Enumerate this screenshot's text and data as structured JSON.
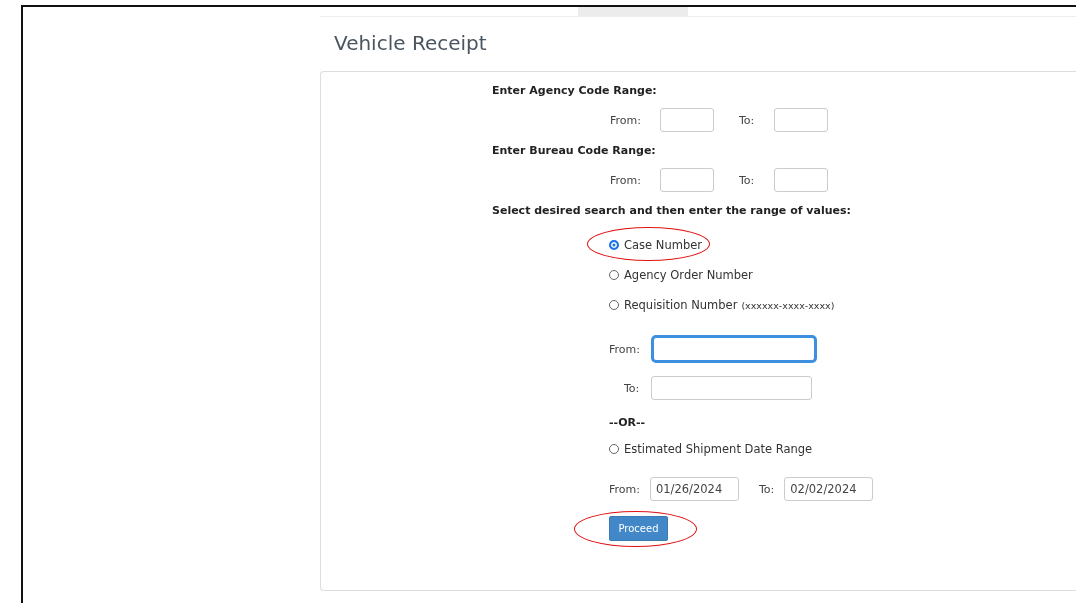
{
  "page": {
    "title": "Vehicle Receipt"
  },
  "agency_range": {
    "heading": "Enter Agency Code Range:",
    "from_label": "From:",
    "to_label": "To:"
  },
  "bureau_range": {
    "heading": "Enter Bureau Code Range:",
    "from_label": "From:",
    "to_label": "To:"
  },
  "search_heading": "Select desired search and then enter the range of values:",
  "search_options": [
    {
      "label": "Case Number",
      "selected": true,
      "circled": true
    },
    {
      "label": "Agency Order Number",
      "selected": false,
      "circled": false
    },
    {
      "label": "Requisition Number",
      "hint": "(xxxxxx-xxxx-xxxx)",
      "selected": false,
      "circled": false
    }
  ],
  "number_range": {
    "from_label": "From:",
    "from_focused": true,
    "to_label": "To:"
  },
  "or_text": "--OR--",
  "date_option": {
    "label": "Estimated Shipment Date Range",
    "selected": false
  },
  "date_range": {
    "from_label": "From:",
    "from_value": "01/26/2024",
    "to_label": "To:",
    "to_value": "02/02/2024"
  },
  "proceed_button": {
    "label": "Proceed",
    "circled": true
  }
}
